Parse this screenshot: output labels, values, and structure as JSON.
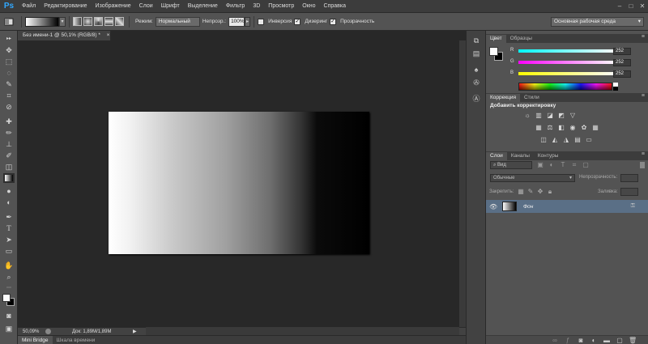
{
  "app": {
    "logo": "Ps"
  },
  "menu": {
    "items": [
      "Файл",
      "Редактирование",
      "Изображение",
      "Слои",
      "Шрифт",
      "Выделение",
      "Фильтр",
      "3D",
      "Просмотр",
      "Окно",
      "Справка"
    ]
  },
  "window_controls": [
    "–",
    "□",
    "✕"
  ],
  "options": {
    "mode_label": "Режим:",
    "mode_value": "Нормальный",
    "opacity_label": "Непрозр.:",
    "opacity_value": "100%",
    "reverse_label": "Инверсия",
    "dither_label": "Дизеринг",
    "transparency_label": "Прозрачность",
    "workspace_value": "Основная рабочая среда",
    "reverse_checked": false,
    "dither_checked": true,
    "transparency_checked": true
  },
  "document": {
    "tab_title": "Без имени-1 @ 50,1% (RGB/8) *",
    "tab_close": "×",
    "zoom": "50,09%",
    "doc_info": "Док: 1,89М/1,89М"
  },
  "bottom_tabs": [
    "Mini Bridge",
    "Шкала времени"
  ],
  "color_panel": {
    "tabs": [
      "Цвет",
      "Образцы"
    ],
    "channels": [
      {
        "label": "R",
        "value": "252",
        "color": "#00e0ff"
      },
      {
        "label": "G",
        "value": "252",
        "color": "#ff3cff"
      },
      {
        "label": "B",
        "value": "252",
        "color": "#ffff30"
      }
    ]
  },
  "adjustments_panel": {
    "tabs": [
      "Коррекция",
      "Стили"
    ],
    "heading": "Добавить корректировку"
  },
  "layers_panel": {
    "tabs": [
      "Слои",
      "Каналы",
      "Контуры"
    ],
    "filter_label": "Вид",
    "blend_mode": "Обычные",
    "opacity_label": "Непрозрачность:",
    "lock_label": "Закрепить:",
    "fill_label": "Заливка:",
    "layers": [
      {
        "name": "Фон",
        "locked": true
      }
    ]
  },
  "colors": {
    "accent": "#31a8ff",
    "selected_layer": "#5a6f86"
  }
}
